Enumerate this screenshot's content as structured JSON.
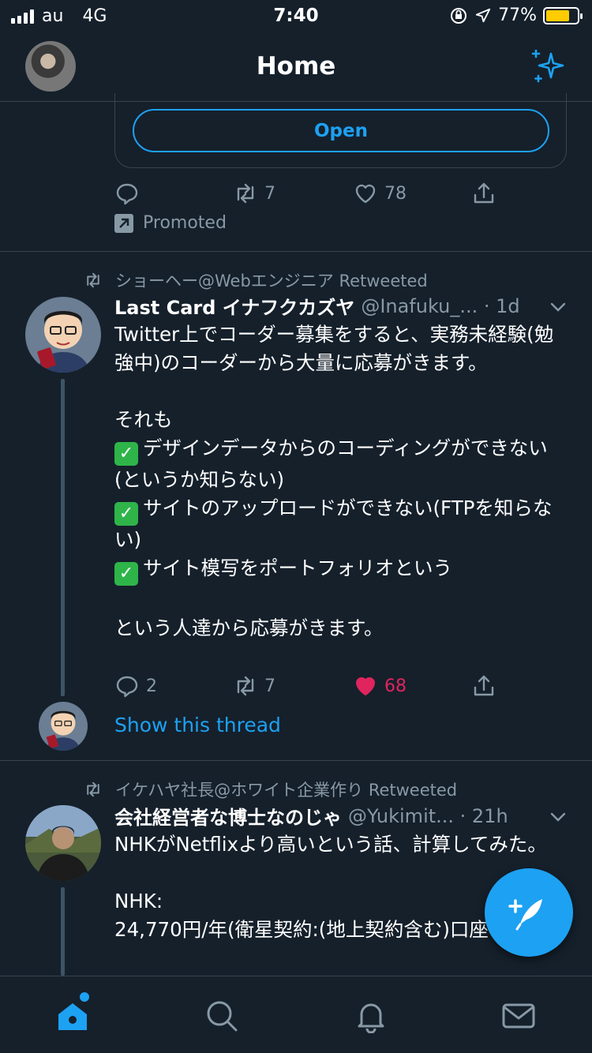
{
  "status_bar": {
    "carrier": "au",
    "network": "4G",
    "time": "7:40",
    "battery": "77%",
    "battery_level": 0.77,
    "battery_color": "#ffcc00"
  },
  "header": {
    "title": "Home",
    "icon": "sparkle-icon"
  },
  "promo": {
    "open_label": "Open",
    "replies": "",
    "retweets": "7",
    "likes": "78",
    "promoted_label": "Promoted"
  },
  "tweets": [
    {
      "retweeted_by": "ショーヘー@Webエンジニア Retweeted",
      "name": "Last Card イナフクカズヤ",
      "meta": "@Inafuku_... · 1d",
      "text": "Twitter上でコーダー募集をすると、実務未経験(勉強中)のコーダーから大量に応募がきます。\n\nそれも\n",
      "bullets": [
        "デザインデータからのコーディングができない(というか知らない)",
        "サイトのアップロードができない(FTPを知らない)",
        "サイト模写をポートフォリオという"
      ],
      "text_end": "\nという人達から応募がきます。",
      "replies": "2",
      "retweets": "7",
      "likes": "68",
      "show_thread": "Show this thread"
    },
    {
      "retweeted_by": "イケハヤ社長@ホワイト企業作り Retweeted",
      "name": "会社経営者な博士なのじゃ",
      "meta": "@Yukimit... · 21h",
      "text": "NHKがNetflixより高いという話、計算してみた。\n\nNHK:\n24,770円/年(衛星契約:(地上契約含む)口座・ク"
    }
  ],
  "colors": {
    "background": "#15202b",
    "accent": "#1da1f2",
    "muted": "#8899a6",
    "border": "#38444d",
    "like": "#e0245e"
  },
  "tabs": [
    "home-icon",
    "search-icon",
    "notifications-icon",
    "messages-icon"
  ]
}
